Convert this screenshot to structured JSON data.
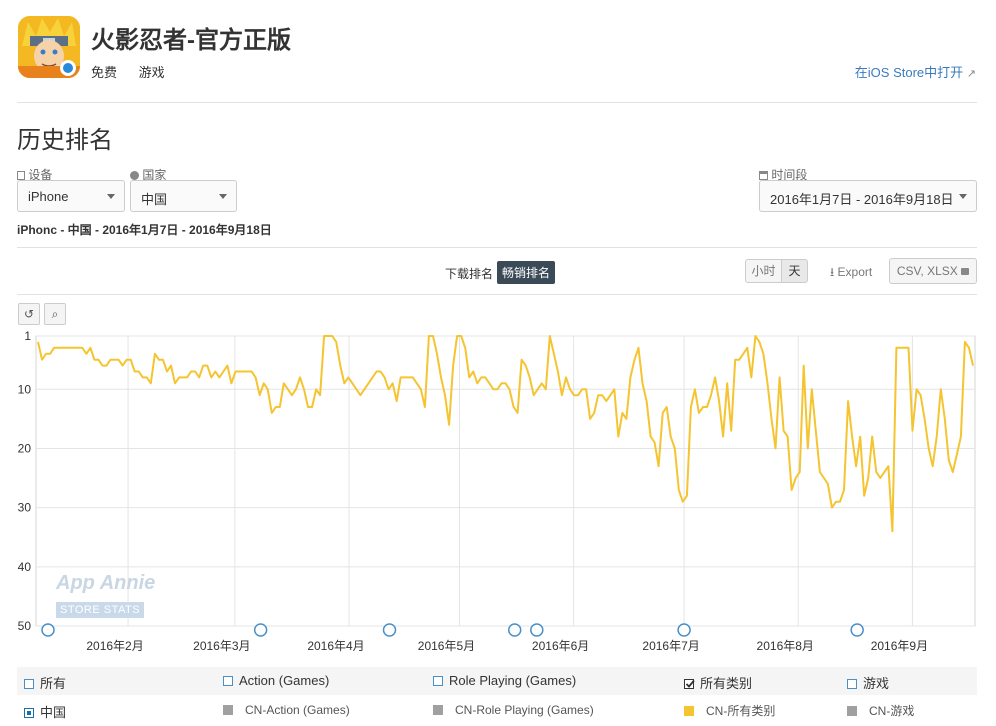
{
  "app": {
    "title": "火影忍者-官方正版",
    "price": "免费",
    "category": "游戏",
    "ios_link": "在iOS Store中打开"
  },
  "section_title": "历史排名",
  "filters": {
    "device_label": "设备",
    "device_value": "iPhone",
    "country_label": "国家",
    "country_value": "中国",
    "period_label": "时间段",
    "period_value": "2016年1月7日 - 2016年9月18日"
  },
  "subtitle": "iPhonc - 中国 - 2016年1月7日 - 2016年9月18日",
  "tabs": {
    "download": "下载排名",
    "grossing": "畅销排名"
  },
  "granularity": {
    "hour": "小时",
    "day": "天"
  },
  "export": {
    "label": "Export",
    "format": "CSV, XLSX"
  },
  "watermark": {
    "brand": "App Annie",
    "sub": "STORE STATS"
  },
  "legend": {
    "row1": [
      "所有",
      "Action (Games)",
      "Role Playing (Games)",
      "所有类别",
      "游戏"
    ],
    "row2": [
      "中国",
      "CN-Action (Games)",
      "CN-Role Playing (Games)",
      "CN-所有类别",
      "CN-游戏"
    ],
    "row1_checked": [
      false,
      false,
      false,
      true,
      false
    ]
  },
  "colors": {
    "series": "#f5c431",
    "accent": "#3a7bbf",
    "tab_active": "#3b4a57",
    "inactive_swatch": "#a0a0a0"
  },
  "chart_data": {
    "type": "line",
    "ylabel": "",
    "ylim": [
      1,
      50
    ],
    "y_reversed": true,
    "yticks": [
      1,
      10,
      20,
      30,
      40,
      50
    ],
    "xlim": [
      "2016-01-07",
      "2016-09-18"
    ],
    "xticks": [
      "2016年2月",
      "2016年3月",
      "2016年4月",
      "2016年5月",
      "2016年6月",
      "2016年7月",
      "2016年8月",
      "2016年9月"
    ],
    "grid": true,
    "event_marker_dates": [
      "2016-01-07",
      "2016-03-08",
      "2016-04-12",
      "2016-05-16",
      "2016-05-22",
      "2016-07-01",
      "2016-08-17"
    ],
    "series": [
      {
        "values": [
          2,
          5,
          4,
          4,
          3,
          3,
          3,
          3,
          3,
          3,
          3,
          3,
          4,
          3,
          5,
          5,
          6,
          6,
          5,
          5,
          5,
          6,
          5,
          5,
          7,
          7,
          8,
          8,
          9,
          4,
          5,
          5,
          7,
          6,
          9,
          8,
          8,
          8,
          7,
          7,
          8,
          6,
          6,
          8,
          7,
          8,
          7,
          6,
          9,
          7,
          7,
          7,
          7,
          7,
          8,
          11,
          9,
          10,
          14,
          13,
          13,
          9,
          10,
          11,
          10,
          8,
          10,
          13,
          13,
          10,
          11,
          1,
          1,
          1,
          2,
          6,
          9,
          8,
          9,
          10,
          11,
          10,
          9,
          8,
          7,
          7,
          8,
          10,
          9,
          12,
          8,
          8,
          8,
          8,
          9,
          10,
          13,
          1,
          1,
          4,
          8,
          11,
          16,
          6,
          1,
          1,
          3,
          8,
          7,
          9,
          8,
          8,
          9,
          10,
          10,
          9,
          9,
          10,
          13,
          14,
          5,
          6,
          8,
          11,
          10,
          9,
          10,
          1,
          4,
          7,
          11,
          8,
          10,
          11,
          11,
          10,
          10,
          15,
          14,
          11,
          11,
          12,
          11,
          10,
          18,
          14,
          15,
          8,
          5,
          3,
          9,
          12,
          18,
          19,
          23,
          14,
          13,
          18,
          20,
          27,
          29,
          28,
          13,
          10,
          14,
          13,
          13,
          11,
          8,
          12,
          18,
          9,
          17,
          5,
          5,
          4,
          3,
          8,
          1,
          2,
          4,
          9,
          15,
          20,
          8,
          17,
          18,
          27,
          25,
          24,
          6,
          20,
          10,
          17,
          24,
          25,
          26,
          30,
          29,
          29,
          27,
          12,
          18,
          23,
          18,
          28,
          25,
          18,
          24,
          25,
          24,
          23,
          34,
          3,
          3,
          3,
          3,
          17,
          10,
          11,
          15,
          20,
          23,
          18,
          10,
          15,
          22,
          24,
          21,
          18,
          2,
          3,
          6
        ]
      }
    ]
  }
}
